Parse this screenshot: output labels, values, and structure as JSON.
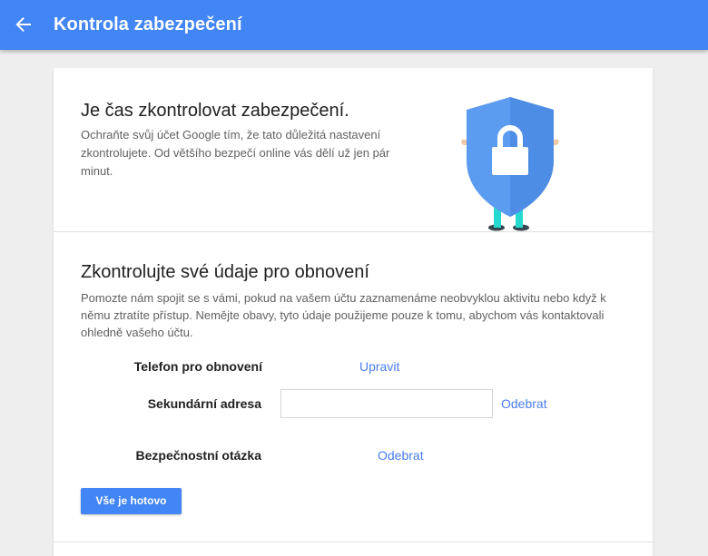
{
  "header": {
    "back_icon": "arrow-back-icon",
    "title": "Kontrola zabezpečení"
  },
  "intro": {
    "heading": "Je čas zkontrolovat zabezpečení.",
    "text": "Ochraňte svůj účet Google tím, že tato důležitá nastavení zkontrolujete. Od většího bezpečí online vás dělí už jen pár minut.",
    "illustration": "shield-lock-character-icon"
  },
  "recovery": {
    "heading": "Zkontrolujte své údaje pro obnovení",
    "text": "Pomozte nám spojit se s vámi, pokud na vašem účtu zaznamenáme neobvyklou aktivitu nebo když k němu ztratíte přístup. Nemějte obavy, tyto údaje použijeme pouze k tomu, abychom vás kontaktovali ohledně vašeho účtu.",
    "phone_label": "Telefon pro obnovení",
    "phone_action": "Upravit",
    "email_label": "Sekundární adresa",
    "email_value": "",
    "email_action": "Odebrat",
    "question_label": "Bezpečnostní otázka",
    "question_action": "Odebrat",
    "done_button": "Vše je hotovo"
  },
  "colors": {
    "accent": "#4285f4",
    "link": "#4a7df0",
    "shield": "#5c9cf0"
  }
}
